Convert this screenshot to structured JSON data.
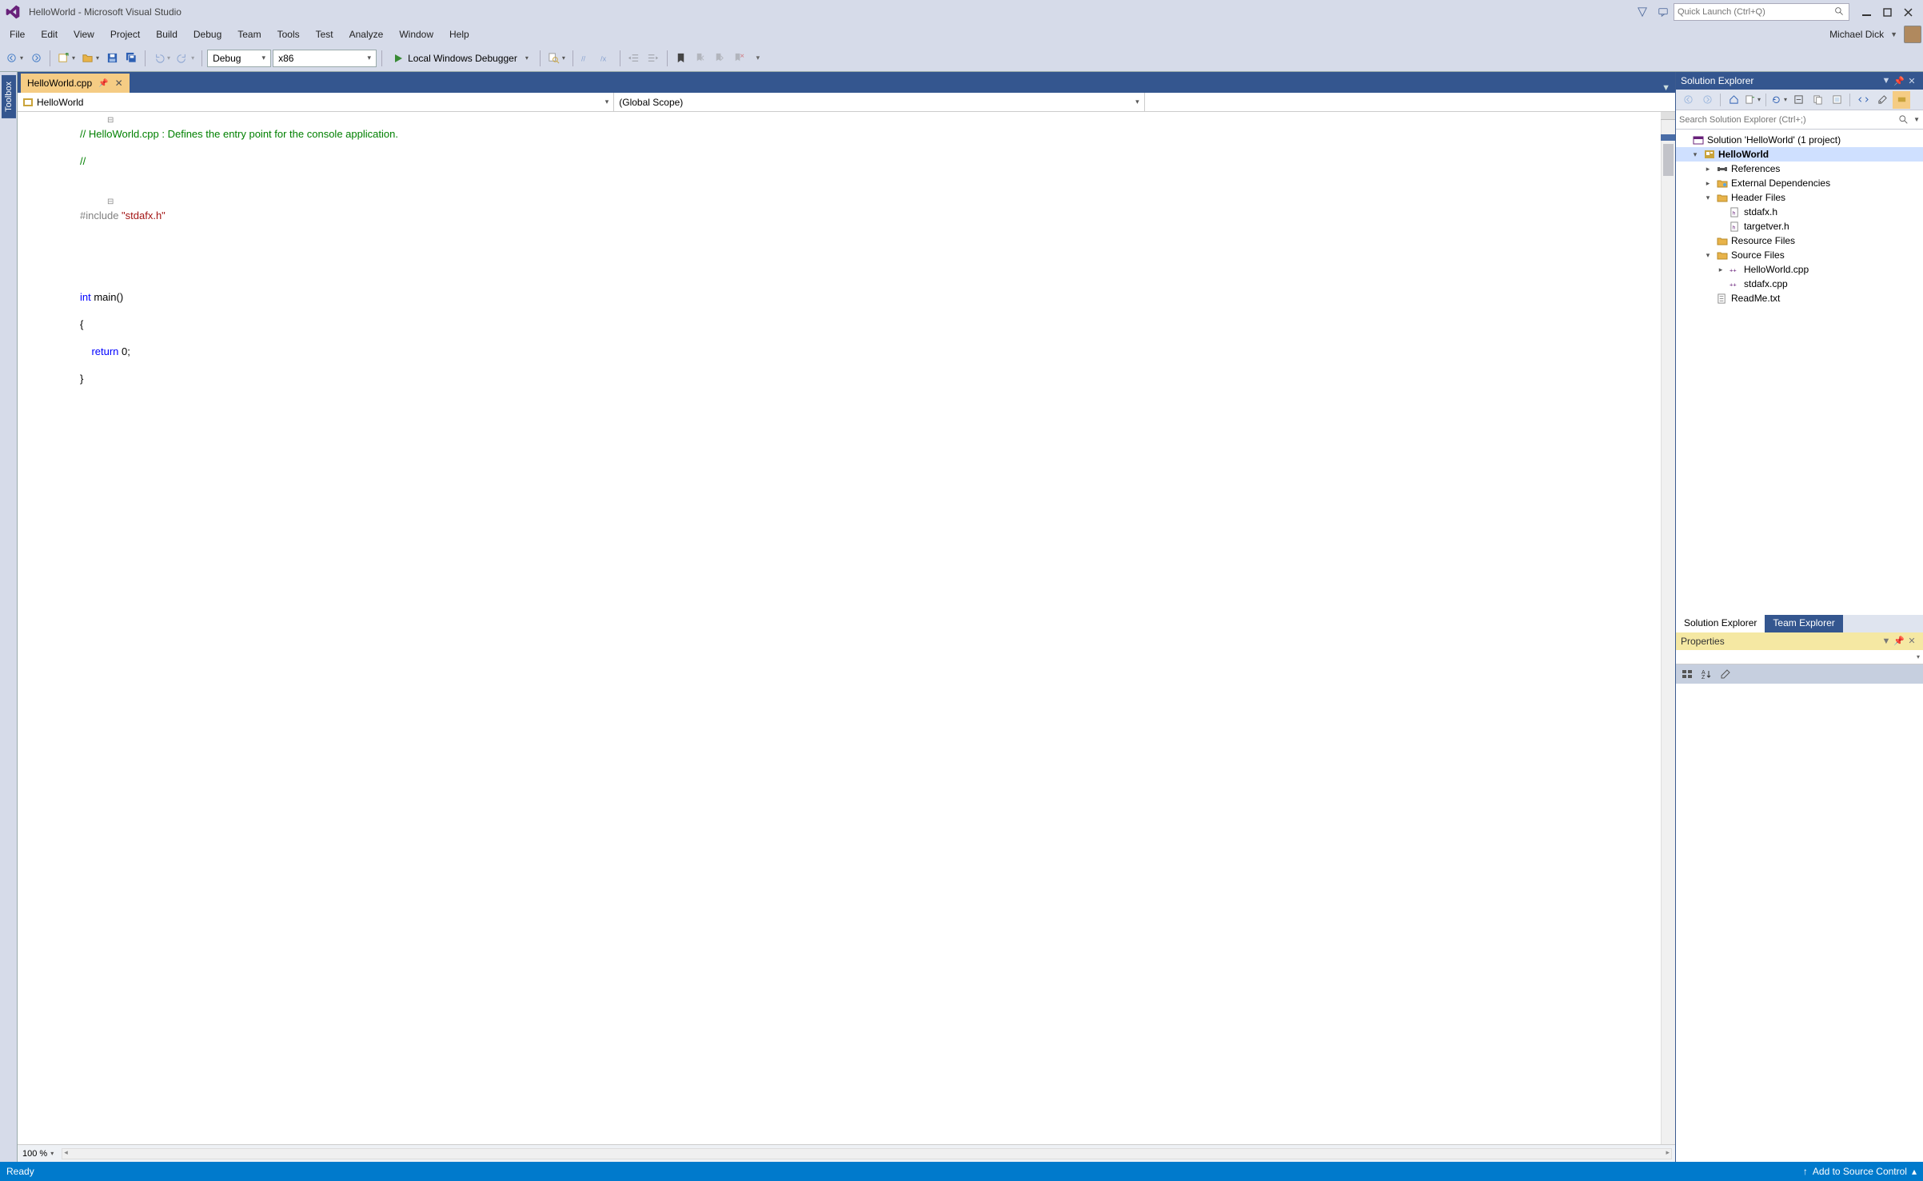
{
  "title": "HelloWorld - Microsoft Visual Studio",
  "quick_launch_placeholder": "Quick Launch (Ctrl+Q)",
  "menu": {
    "items": [
      "File",
      "Edit",
      "View",
      "Project",
      "Build",
      "Debug",
      "Team",
      "Tools",
      "Test",
      "Analyze",
      "Window",
      "Help"
    ]
  },
  "user_name": "Michael Dick",
  "toolbar": {
    "config": "Debug",
    "platform": "x86",
    "debug_target": "Local Windows Debugger"
  },
  "toolbox_label": "Toolbox",
  "doc_tab": {
    "name": "HelloWorld.cpp"
  },
  "nav": {
    "project": "HelloWorld",
    "scope": "(Global Scope)",
    "member": ""
  },
  "code": {
    "l1a": "// ",
    "l1b": "HelloWorld.cpp : Defines the entry point for the console application.",
    "l2": "//",
    "l3a": "#include ",
    "l3b": "\"stdafx.h\"",
    "l4a": "int",
    "l4b": " main()",
    "l5": "{",
    "l6a": "    ",
    "l6b": "return",
    "l6c": " 0;",
    "l7": "}"
  },
  "zoom": "100 %",
  "solution_explorer": {
    "title": "Solution Explorer",
    "search_placeholder": "Search Solution Explorer (Ctrl+;)",
    "solution": "Solution 'HelloWorld' (1 project)",
    "project": "HelloWorld",
    "nodes": {
      "references": "References",
      "external_deps": "External Dependencies",
      "header_files": "Header Files",
      "stdafx_h": "stdafx.h",
      "targetver_h": "targetver.h",
      "resource_files": "Resource Files",
      "source_files": "Source Files",
      "helloworld_cpp": "HelloWorld.cpp",
      "stdafx_cpp": "stdafx.cpp",
      "readme": "ReadMe.txt"
    },
    "tabs": {
      "active": "Solution Explorer",
      "other": "Team Explorer"
    }
  },
  "properties": {
    "title": "Properties"
  },
  "status": {
    "ready": "Ready",
    "source_control": "Add to Source Control"
  }
}
